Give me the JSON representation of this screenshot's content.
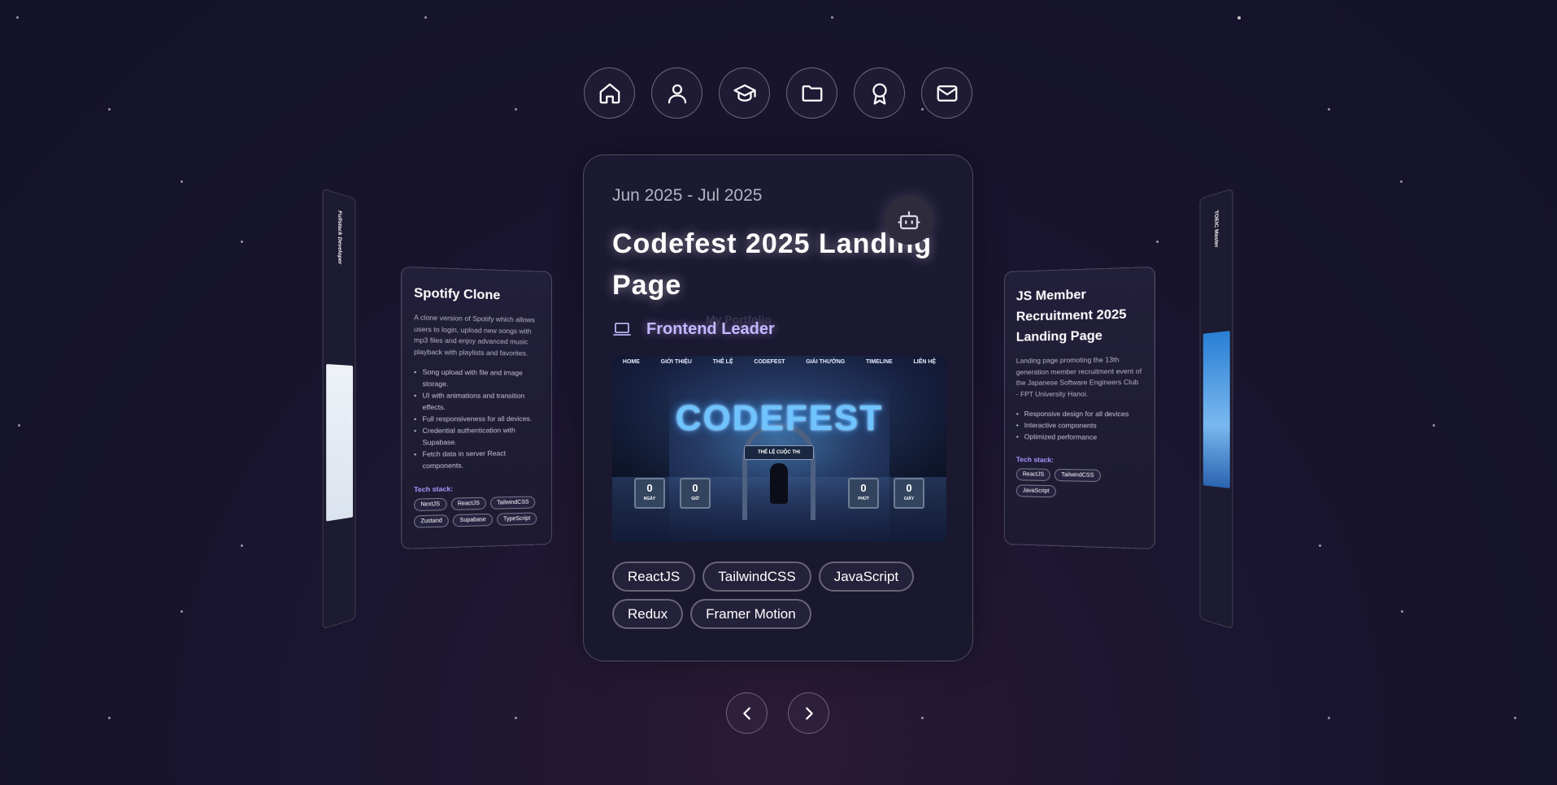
{
  "nav": {
    "items": [
      {
        "icon": "home-icon"
      },
      {
        "icon": "user-icon"
      },
      {
        "icon": "graduation-cap-icon"
      },
      {
        "icon": "folder-icon"
      },
      {
        "icon": "award-icon"
      },
      {
        "icon": "mail-icon"
      }
    ]
  },
  "main_card": {
    "date": "Jun 2025 - Jul 2025",
    "title": "Codefest 2025 Landing Page",
    "ghost_text": "My Portfolio",
    "role": "Frontend Leader",
    "preview": {
      "nav": [
        "HOME",
        "GIỚI THIỆU",
        "THỂ LỆ",
        "CODEFEST",
        "GIẢI THƯỞNG",
        "TIMELINE",
        "LIÊN HỆ"
      ],
      "logo": "CODEFEST",
      "button": "THỂ LỆ CUỘC THI",
      "counters": [
        {
          "value": "0",
          "unit": "NGÀY"
        },
        {
          "value": "0",
          "unit": "GIỜ"
        },
        {
          "value": "0",
          "unit": "PHÚT"
        },
        {
          "value": "0",
          "unit": "GIÂY"
        }
      ]
    },
    "tags": [
      "ReactJS",
      "TailwindCSS",
      "JavaScript",
      "Redux",
      "Framer Motion"
    ]
  },
  "left_card": {
    "title": "Spotify Clone",
    "description": "A clone version of Spotify which allows users to login, upload new songs with mp3 files and enjoy advanced music playback with playlists and favorites.",
    "features": [
      "Song upload with file and image storage.",
      "UI with animations and transition effects.",
      "Full responsiveness for all devices.",
      "Credential authentication with Supabase.",
      "Fetch data in server React components."
    ],
    "stack_label": "Tech stack:",
    "tags": [
      "NextJS",
      "ReactJS",
      "TailwindCSS",
      "Zustand",
      "Supabase",
      "TypeScript"
    ]
  },
  "right_card": {
    "title": "JS Member Recruitment 2025 Landing Page",
    "description": "Landing page promoting the 13th generation member recruitment event of the Japanese Software Engineers Club - FPT University Hanoi.",
    "features": [
      "Responsive design for all devices",
      "Interactive components",
      "Optimized performance"
    ],
    "stack_label": "Tech stack:",
    "tags": [
      "ReactJS",
      "TailwindCSS",
      "JavaScript"
    ]
  },
  "far_left": {
    "text": "Fullstack Developer"
  },
  "far_right": {
    "text": "TOEIC Master"
  },
  "arrows": {
    "prev": "chevron-left-icon",
    "next": "chevron-right-icon"
  }
}
